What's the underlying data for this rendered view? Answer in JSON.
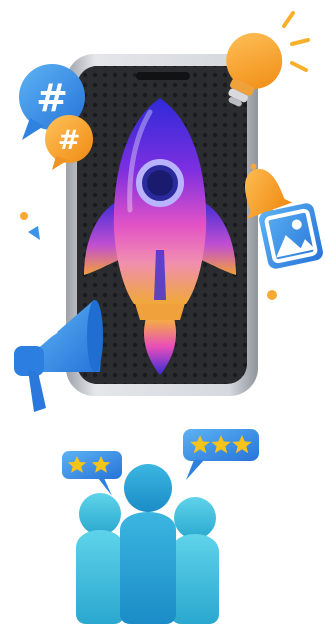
{
  "hashtag_bubbles": {
    "large": {
      "symbol": "#",
      "icon": "hashtag-bubble-icon",
      "color": "#3d9be9"
    },
    "small": {
      "symbol": "#",
      "icon": "hashtag-bubble-icon",
      "color": "#f5a623"
    }
  },
  "phone": {
    "icon": "smartphone-icon",
    "frame_color": "#c9ccd1",
    "screen_color": "#2a2b2f"
  },
  "rocket": {
    "icon": "rocket-icon",
    "colors": [
      "#3a2bd6",
      "#8c2bd8",
      "#e24fc0",
      "#f2a43a"
    ]
  },
  "lightbulb": {
    "icon": "lightbulb-icon",
    "color": "#f7a21b"
  },
  "bell": {
    "icon": "bell-icon",
    "color": "#f5a24a"
  },
  "picture_card": {
    "icon": "image-icon",
    "color": "#3a8ee6"
  },
  "megaphone": {
    "icon": "megaphone-icon",
    "color": "#2f87e6"
  },
  "rating_bubbles": {
    "left": {
      "stars": 2,
      "icon": "star-rating-bubble-icon",
      "bubble_color": "#3d8fe6",
      "star_color": "#f6c31b"
    },
    "right": {
      "stars": 3,
      "icon": "star-rating-bubble-icon",
      "bubble_color": "#3d8fe6",
      "star_color": "#f6c31b"
    }
  },
  "audience": {
    "icon": "user-group-icon",
    "color": "#39c0da"
  }
}
